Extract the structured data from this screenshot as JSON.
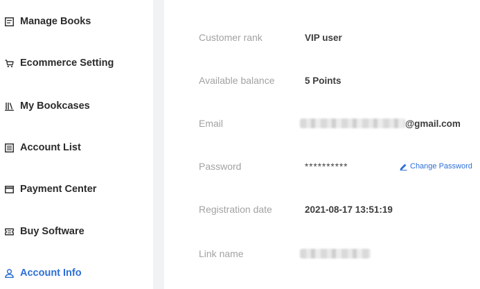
{
  "sidebar": {
    "items": [
      {
        "label": "Manage Books",
        "icon": "book-list-icon",
        "active": false
      },
      {
        "label": "Ecommerce Setting",
        "icon": "cart-icon",
        "active": false
      },
      {
        "label": "My Bookcases",
        "icon": "bookcase-icon",
        "active": false
      },
      {
        "label": "Account List",
        "icon": "list-icon",
        "active": false
      },
      {
        "label": "Payment Center",
        "icon": "card-icon",
        "active": false
      },
      {
        "label": "Buy Software",
        "icon": "ticket-icon",
        "active": false
      },
      {
        "label": "Account Info",
        "icon": "user-icon",
        "active": true
      }
    ],
    "active_color": "#2d6fd6"
  },
  "account": {
    "rank": {
      "label": "Customer rank",
      "value": "VIP user"
    },
    "balance": {
      "label": "Available balance",
      "value": "5 Points"
    },
    "email": {
      "label": "Email",
      "value_suffix": "@gmail.com"
    },
    "password": {
      "label": "Password",
      "value": "**********",
      "change_label": "Change Password"
    },
    "registration": {
      "label": "Registration date",
      "value": "2021-08-17 13:51:19"
    },
    "link_name": {
      "label": "Link name"
    }
  }
}
